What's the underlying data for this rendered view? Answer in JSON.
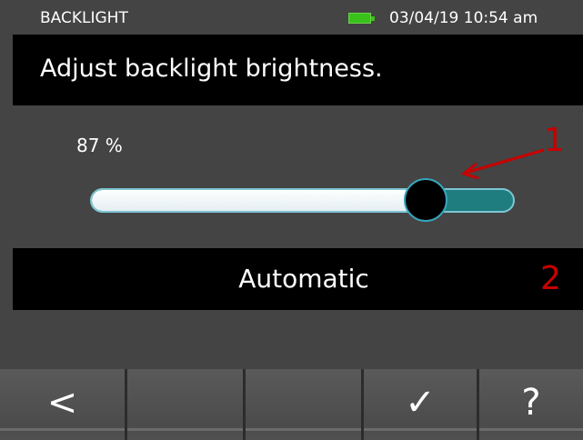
{
  "status_bar": {
    "title": "BACKLIGHT",
    "datetime": "03/04/19 10:54 am",
    "battery_icon": "battery-full-icon",
    "battery_color": "#39c21b"
  },
  "header": {
    "text": "Adjust backlight brightness."
  },
  "slider": {
    "value_label": "87 %",
    "value_fraction": 0.87,
    "fill_color": "#ffffff",
    "track_color": "#1f7d7f"
  },
  "automatic": {
    "label": "Automatic"
  },
  "callouts": {
    "one": "1",
    "two": "2",
    "color": "#c80000"
  },
  "softkeys": [
    {
      "label": "<",
      "icon": "back-icon"
    },
    {
      "label": "",
      "icon": ""
    },
    {
      "label": "",
      "icon": ""
    },
    {
      "label": "✓",
      "icon": "check-icon"
    },
    {
      "label": "?",
      "icon": "help-icon"
    }
  ]
}
